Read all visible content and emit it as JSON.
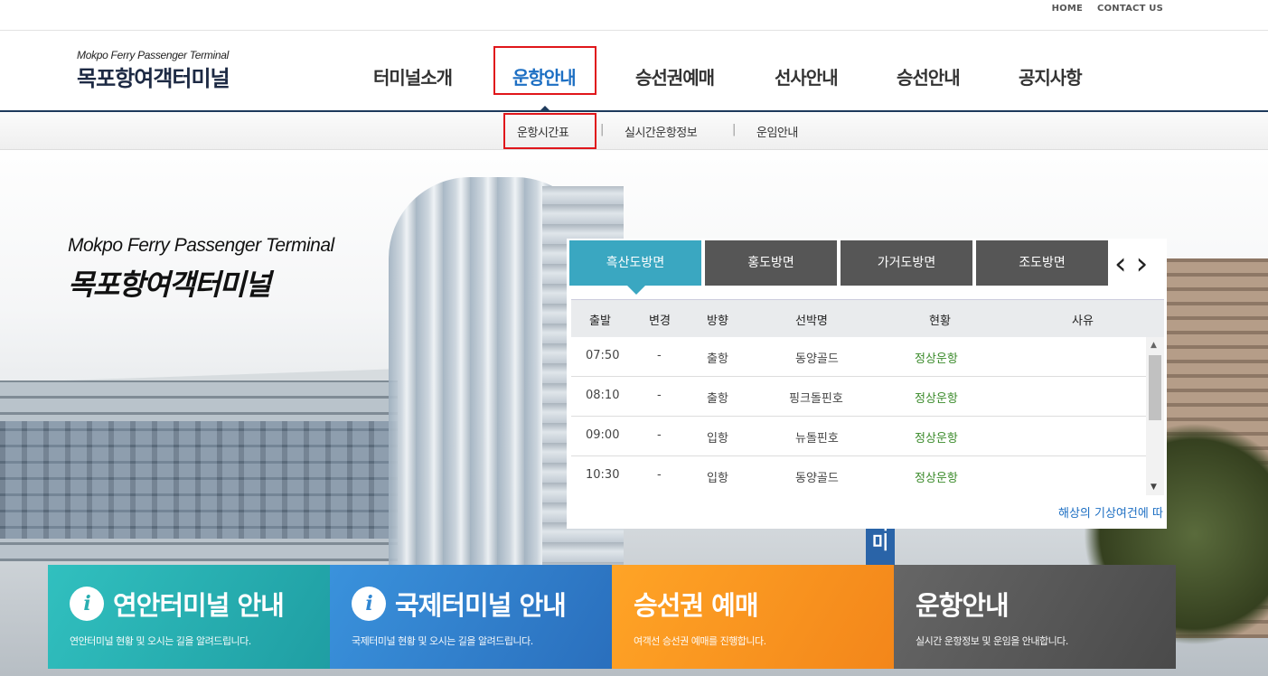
{
  "top_links": [
    "HOME",
    "CONTACT US"
  ],
  "logo": {
    "en": "Mokpo Ferry Passenger Terminal",
    "kr": "목포항여객터미널"
  },
  "gnb": [
    "터미널소개",
    "운항안내",
    "승선권예매",
    "선사안내",
    "승선안내",
    "공지사항"
  ],
  "gnb_active_index": 1,
  "subnav": {
    "items": [
      "운항시간표",
      "실시간운항정보",
      "운임안내"
    ],
    "separator": "|"
  },
  "hero": {
    "en": "Mokpo Ferry Passenger Terminal",
    "kr": "목포항여객터미널",
    "sign_text": "터\n미"
  },
  "schedule": {
    "tabs": [
      "흑산도방면",
      "홍도방면",
      "가거도방면",
      "조도방면"
    ],
    "active_tab": 0,
    "prev_icon": "‹",
    "next_icon": "›",
    "headers": [
      "출발",
      "변경",
      "방향",
      "선박명",
      "현황",
      "사유"
    ],
    "rows": [
      {
        "time": "07:50",
        "change": "-",
        "dir": "출항",
        "ship": "동양골드",
        "status": "정상운항",
        "reason": ""
      },
      {
        "time": "08:10",
        "change": "-",
        "dir": "출항",
        "ship": "핑크돌핀호",
        "status": "정상운항",
        "reason": ""
      },
      {
        "time": "09:00",
        "change": "-",
        "dir": "입항",
        "ship": "뉴돌핀호",
        "status": "정상운항",
        "reason": ""
      },
      {
        "time": "10:30",
        "change": "-",
        "dir": "입항",
        "ship": "동양골드",
        "status": "정상운항",
        "reason": ""
      }
    ],
    "ticker": "해상의 기상여건에 따"
  },
  "cards": [
    {
      "title": "연안터미널 안내",
      "desc": "연안터미널 현황 및 오시는 길을 알려드립니다.",
      "icon": "info-icon",
      "color": "#2bb3b3"
    },
    {
      "title": "국제터미널 안내",
      "desc": "국제터미널 현황 및 오시는 길을 알려드립니다.",
      "icon": "info-icon",
      "color": "#2f86d2"
    },
    {
      "title": "승선권 예매",
      "desc": "여객선 승선권 예매를 진행합니다.",
      "icon": "",
      "color": "#f7931e"
    },
    {
      "title": "운항안내",
      "desc": "실시간 운항정보 및 운임을 안내합니다.",
      "icon": "",
      "color": "#555555"
    }
  ]
}
